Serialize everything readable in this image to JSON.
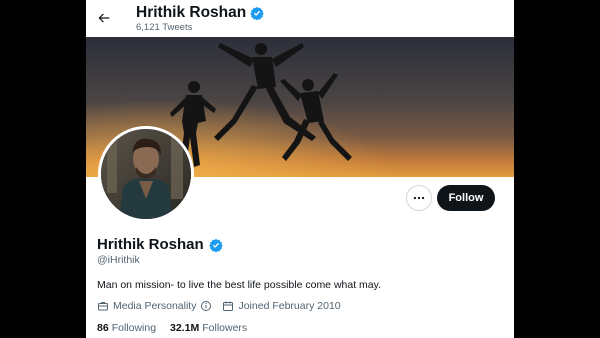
{
  "header": {
    "name": "Hrithik Roshan",
    "tweet_count": "6,121 Tweets",
    "back_icon": "arrow-left-icon"
  },
  "profile": {
    "display_name": "Hrithik Roshan",
    "handle": "@iHrithik",
    "bio": "Man on mission- to live the best life possible come what may.",
    "category": "Media Personality",
    "joined": "Joined February 2010",
    "following_count": "86",
    "following_label": "Following",
    "followers_count": "32.1M",
    "followers_label": "Followers"
  },
  "actions": {
    "follow_label": "Follow",
    "more_icon": "more-horizontal-icon"
  },
  "colors": {
    "verified_blue": "#1d9bf0",
    "follow_bg": "#0f1419",
    "muted_text": "#536471",
    "backdrop": "#000000"
  }
}
